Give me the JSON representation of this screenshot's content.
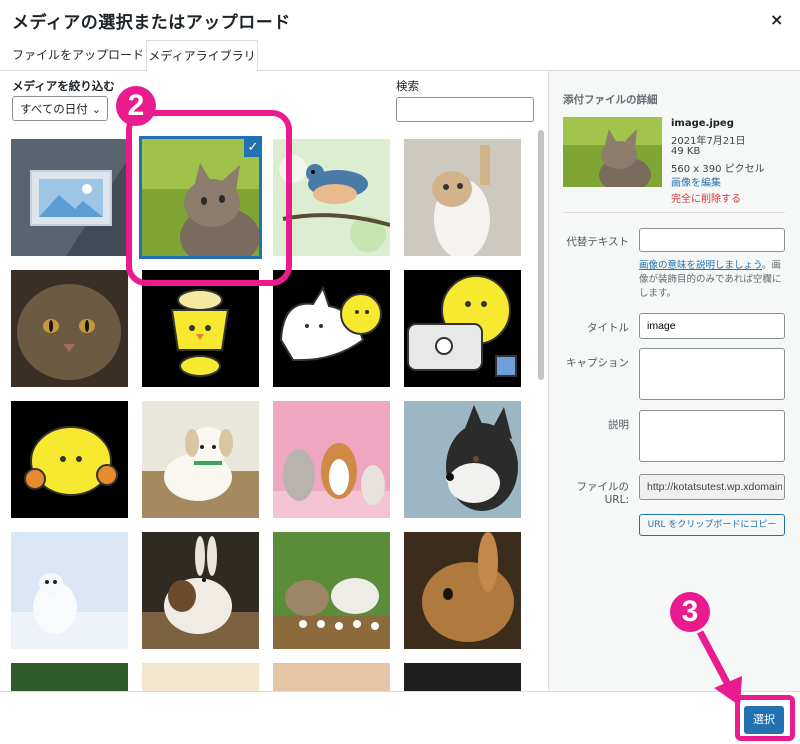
{
  "dialog": {
    "title": "メディアの選択またはアップロード",
    "close_symbol": "×"
  },
  "tabs": [
    {
      "label": "ファイルをアップロード"
    },
    {
      "label": "メディアライブラリ",
      "active": true
    }
  ],
  "filters": {
    "label": "メディアを絞り込む",
    "date_select": "すべての日付",
    "search_label": "検索",
    "search_value": ""
  },
  "media_grid": [
    {
      "name": "placeholder"
    },
    {
      "name": "cat-looking-up",
      "selected": true
    },
    {
      "name": "bird-on-branch"
    },
    {
      "name": "kitten-reaching"
    },
    {
      "name": "tabby-cat"
    },
    {
      "name": "chick-lamp"
    },
    {
      "name": "cat-and-chick"
    },
    {
      "name": "chick-with-laptop"
    },
    {
      "name": "chick-with-flowers"
    },
    {
      "name": "white-puppy"
    },
    {
      "name": "dogs-pink"
    },
    {
      "name": "husky"
    },
    {
      "name": "arctic-fox"
    },
    {
      "name": "rabbit-brown-white"
    },
    {
      "name": "rabbits-flowers"
    },
    {
      "name": "brown-rabbit"
    },
    {
      "name": "partial-plant"
    },
    {
      "name": "partial-light"
    },
    {
      "name": "partial-cat"
    },
    {
      "name": "partial-dark"
    }
  ],
  "details": {
    "header": "添付ファイルの詳細",
    "filename": "image.jpeg",
    "date": "2021年7月21日",
    "size": "49 KB",
    "dimensions": "560 x 390 ピクセル",
    "edit_link": "画像を編集",
    "delete_link": "完全に削除する",
    "alt_label": "代替テキスト",
    "alt_value": "",
    "alt_help_link": "画像の意味を説明しましょう",
    "alt_help_text": "。画像が装飾目的のみであれば空欄にします。",
    "title_label": "タイトル",
    "title_value": "image",
    "caption_label": "キャプション",
    "caption_value": "",
    "description_label": "説明",
    "description_value": "",
    "url_label_1": "ファイルの",
    "url_label_2": "URL:",
    "url_value": "http://kotatsutest.wp.xdomain",
    "copy_button": "URL をクリップボードにコピー"
  },
  "footer": {
    "select_button": "選択"
  },
  "annotations": {
    "step2": "2",
    "step3": "3",
    "color": "#ea1a8f"
  },
  "colors": {
    "primary": "#2271b1",
    "danger": "#d63638",
    "highlight": "#ea1a8f"
  }
}
